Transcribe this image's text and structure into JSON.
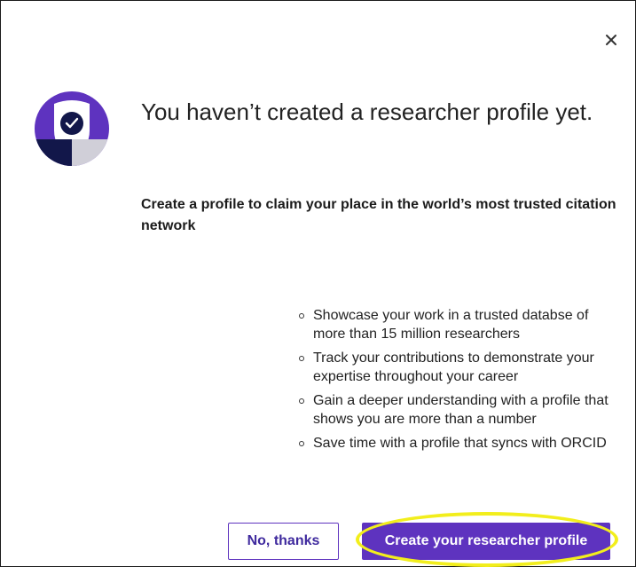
{
  "dialog": {
    "close_label": "×",
    "title": "You haven’t created a researcher profile yet.",
    "subtitle": "Create a profile to claim your place in the world’s most trusted citation network",
    "benefits": [
      "Showcase your work in a trusted databse of more than 15 million researchers",
      "Track your contributions to demonstrate your expertise throughout your career",
      "Gain a deeper understanding with a profile that shows you are more than a number",
      "Save time with a profile that syncs with ORCID"
    ],
    "secondary_button": "No, thanks",
    "primary_button": "Create your researcher profile"
  },
  "icons": {
    "close": "close-icon",
    "logo": "shield-check-icon"
  },
  "colors": {
    "accent": "#5e33bf",
    "accent_dark": "#12174a",
    "highlight": "#f2ee1c"
  }
}
